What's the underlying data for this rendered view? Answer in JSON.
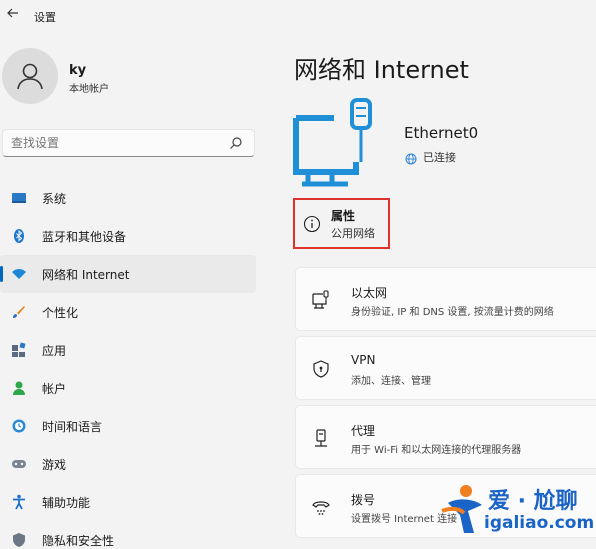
{
  "app": {
    "back_icon": "back-arrow-icon",
    "title": "设置"
  },
  "user": {
    "name": "ky",
    "account_type": "本地帐户"
  },
  "search": {
    "placeholder": "查找设置"
  },
  "sidebar": {
    "items": [
      {
        "label": "系统",
        "icon": "system-icon",
        "active": false
      },
      {
        "label": "蓝牙和其他设备",
        "icon": "bluetooth-icon",
        "active": false
      },
      {
        "label": "网络和 Internet",
        "icon": "network-icon",
        "active": true
      },
      {
        "label": "个性化",
        "icon": "personalize-icon",
        "active": false
      },
      {
        "label": "应用",
        "icon": "apps-icon",
        "active": false
      },
      {
        "label": "帐户",
        "icon": "account-icon",
        "active": false
      },
      {
        "label": "时间和语言",
        "icon": "time-language-icon",
        "active": false
      },
      {
        "label": "游戏",
        "icon": "gaming-icon",
        "active": false
      },
      {
        "label": "辅助功能",
        "icon": "accessibility-icon",
        "active": false
      },
      {
        "label": "隐私和安全性",
        "icon": "privacy-icon",
        "active": false
      }
    ]
  },
  "main": {
    "title": "网络和 Internet",
    "adapter": {
      "name": "Ethernet0",
      "status": "已连接"
    },
    "properties": {
      "title": "属性",
      "subtitle": "公用网络"
    },
    "cards": [
      {
        "title": "以太网",
        "subtitle": "身份验证, IP 和 DNS 设置, 按流量计费的网络",
        "icon": "ethernet-icon"
      },
      {
        "title": "VPN",
        "subtitle": "添加、连接、管理",
        "icon": "vpn-shield-icon"
      },
      {
        "title": "代理",
        "subtitle": "用于 Wi-Fi 和以太网连接的代理服务器",
        "icon": "proxy-icon"
      },
      {
        "title": "拨号",
        "subtitle": "设置拨号 Internet 连接",
        "icon": "dialup-icon"
      }
    ]
  },
  "watermark": {
    "line1": "爱 · 尬聊",
    "line2": "igaliao.com"
  },
  "colors": {
    "accent": "#0067c0",
    "highlight_border": "#e0312c",
    "illustration": "#1f8fd8"
  }
}
